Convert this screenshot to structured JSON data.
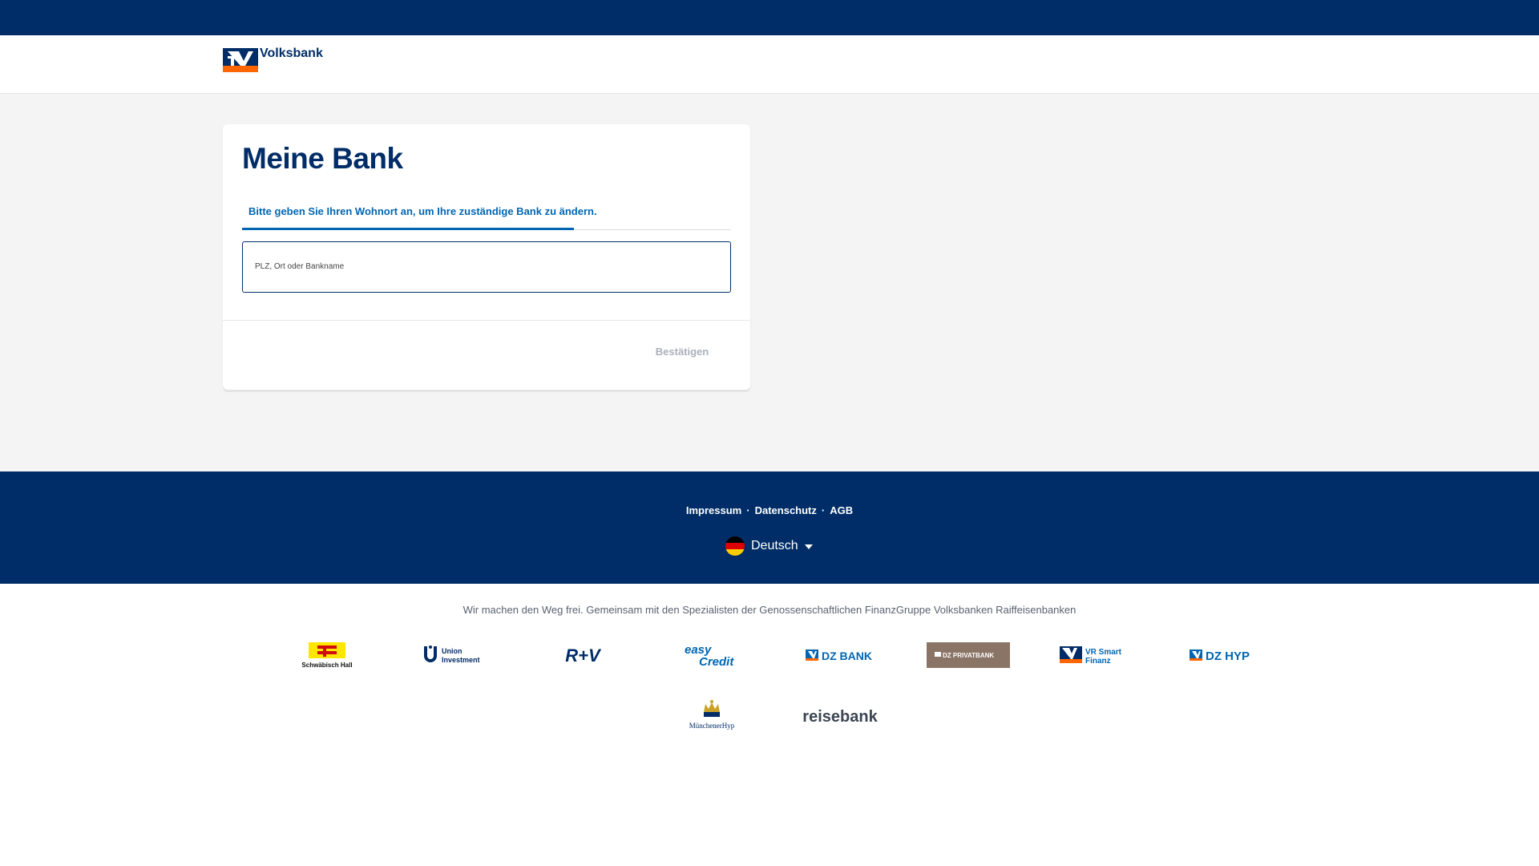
{
  "header": {
    "logo_text": "Volksbank"
  },
  "card": {
    "title": "Meine Bank",
    "tab_label": "Bitte geben Sie Ihren Wohnort an, um Ihre zuständige Bank zu ändern.",
    "search_label": "PLZ, Ort oder Bankname",
    "search_value": "",
    "confirm_label": "Bestätigen"
  },
  "footer": {
    "links": [
      "Impressum",
      "Datenschutz",
      "AGB"
    ],
    "separator": "·",
    "language": "Deutsch",
    "flag_colors": [
      "#000000",
      "#dd0000",
      "#ffce00"
    ]
  },
  "partners": {
    "tagline": "Wir machen den Weg frei. Gemeinsam mit den Spezialisten der Genossenschaftlichen FinanzGruppe Volksbanken Raiffeisenbanken",
    "logos": [
      {
        "name": "schwaebisch-hall",
        "text": "Schwäbisch Hall"
      },
      {
        "name": "union-investment",
        "text_line1": "Union",
        "text_line2": "Investment"
      },
      {
        "name": "r-plus-v",
        "text": "R+V"
      },
      {
        "name": "easycredit",
        "text_line1": "easy",
        "text_line2": "Credit"
      },
      {
        "name": "dz-bank",
        "text": "DZ BANK"
      },
      {
        "name": "dz-privatbank",
        "text": "DZ PRIVATBANK"
      },
      {
        "name": "vr-smart-finanz",
        "text_line1": "VR Smart",
        "text_line2": "Finanz"
      },
      {
        "name": "dz-hyp",
        "text": "DZ HYP"
      },
      {
        "name": "muenchener-hyp",
        "text": "MünchenerHyp"
      },
      {
        "name": "reisebank",
        "text": "reisebank"
      }
    ]
  },
  "colors": {
    "brand_navy": "#002d67",
    "brand_orange": "#ff6600",
    "link_blue": "#0066b3"
  }
}
